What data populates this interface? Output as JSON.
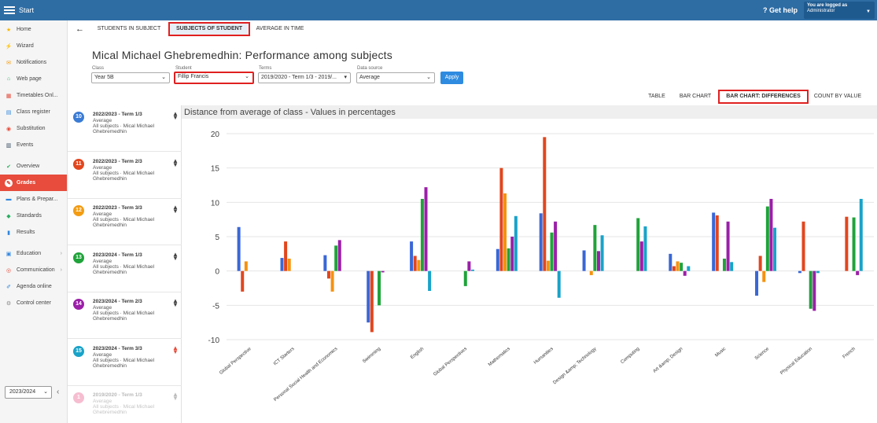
{
  "topbar": {
    "start": "Start",
    "help": "? Get help",
    "login_line1": "You are logged as",
    "login_line2": "Administrator"
  },
  "sidebar": {
    "items": [
      {
        "label": "Home",
        "icon": "star-icon",
        "color": "#f5b800"
      },
      {
        "label": "Wizard",
        "icon": "wand-icon",
        "color": "#e74c3c"
      },
      {
        "label": "Notifications",
        "icon": "envelope-icon",
        "color": "#f39c12"
      },
      {
        "label": "Web page",
        "icon": "house-icon",
        "color": "#27ae60"
      },
      {
        "label": "Timetables Onl...",
        "icon": "calendar-grid-icon",
        "color": "#e74c3c"
      },
      {
        "label": "Class register",
        "icon": "book-icon",
        "color": "#2e86de"
      },
      {
        "label": "Substitution",
        "icon": "user-swap-icon",
        "color": "#e74c3c"
      },
      {
        "label": "Events",
        "icon": "calendar-icon",
        "color": "#34495e"
      },
      {
        "label": "Overview",
        "icon": "check-circle-icon",
        "color": "#27ae60"
      },
      {
        "label": "Grades",
        "icon": "grades-icon",
        "color": "#ffffff"
      },
      {
        "label": "Plans & Prepar...",
        "icon": "plans-icon",
        "color": "#2e86de"
      },
      {
        "label": "Standards",
        "icon": "shield-icon",
        "color": "#27ae60"
      },
      {
        "label": "Results",
        "icon": "bar-chart-icon",
        "color": "#2e86de"
      },
      {
        "label": "Education",
        "icon": "education-icon",
        "color": "#2e86de"
      },
      {
        "label": "Communication",
        "icon": "chat-icon",
        "color": "#e74c3c"
      },
      {
        "label": "Agenda online",
        "icon": "pen-icon",
        "color": "#2e86de"
      },
      {
        "label": "Control center",
        "icon": "gear-icon",
        "color": "#888888"
      }
    ],
    "year": "2023/2024"
  },
  "tabs": {
    "students_in_subject": "STUDENTS IN SUBJECT",
    "subjects_of_student": "SUBJECTS OF STUDENT",
    "average_in_time": "AVERAGE IN TIME"
  },
  "page_title": "Mical Michael Ghebremedhin: Performance among subjects",
  "filters": {
    "class_label": "Class",
    "class_value": "Year 5B",
    "student_label": "Student",
    "student_value": "Fillip Francis",
    "terms_label": "Terms",
    "terms_value": "2019/2020 - Term 1/3 - 2019/...",
    "source_label": "Data source",
    "source_value": "Average",
    "apply": "Apply"
  },
  "view_tabs": {
    "table": "TABLE",
    "bar_chart": "BAR CHART",
    "bar_chart_diff": "BAR CHART: DIFFERENCES",
    "count_by_value": "COUNT BY VALUE"
  },
  "terms": [
    {
      "num": "10",
      "color": "#3a7bd5",
      "title": "2022/2023 - Term 1/3",
      "line1": "Average",
      "line2": "All subjects · Mical Michael Ghebremedhin"
    },
    {
      "num": "11",
      "color": "#e2461e",
      "title": "2022/2023 - Term 2/3",
      "line1": "Average",
      "line2": "All subjects · Mical Michael Ghebremedhin"
    },
    {
      "num": "12",
      "color": "#f39c12",
      "title": "2022/2023 - Term 3/3",
      "line1": "Average",
      "line2": "All subjects · Mical Michael Ghebremedhin"
    },
    {
      "num": "13",
      "color": "#1fa33a",
      "title": "2023/2024 - Term 1/3",
      "line1": "Average",
      "line2": "All subjects · Mical Michael Ghebremedhin"
    },
    {
      "num": "14",
      "color": "#9b1fa8",
      "title": "2023/2024 - Term 2/3",
      "line1": "Average",
      "line2": "All subjects · Mical Michael Ghebremedhin"
    },
    {
      "num": "15",
      "color": "#19a3c9",
      "title": "2023/2024 - Term 3/3",
      "line1": "Average",
      "line2": "All subjects · Mical Michael Ghebremedhin"
    },
    {
      "num": "1",
      "color": "#e8467a",
      "title": "2019/2020 - Term 1/3",
      "line1": "Average",
      "line2": "All subjects · Mical Michael Ghebremedhin"
    }
  ],
  "chart_data": {
    "type": "bar",
    "title": "Distance from average of class - Values in percentages",
    "ylim": [
      -10,
      20
    ],
    "yticks": [
      -10,
      -5,
      0,
      5,
      10,
      15,
      20
    ],
    "grid": true,
    "categories": [
      "Global Perspective",
      "ICT Starters",
      "Personal Social Health and Economics",
      "Swimming",
      "English",
      "Global Perspectives",
      "Mathematics",
      "Humanities",
      "Design &amp; Technology",
      "Computing",
      "Art &amp; Design",
      "Music",
      "Science",
      "Physical Education",
      "French"
    ],
    "series": [
      {
        "color": "#3a67d6",
        "values": [
          6.4,
          1.9,
          2.3,
          -7.5,
          4.3,
          0,
          3.2,
          8.4,
          3.0,
          0,
          2.5,
          8.5,
          -3.6,
          -0.3,
          0
        ]
      },
      {
        "color": "#e2461e",
        "values": [
          -3.0,
          4.3,
          -1.1,
          -8.9,
          2.2,
          0,
          15.0,
          19.5,
          0,
          0,
          0.7,
          8.1,
          2.2,
          7.2,
          7.9
        ]
      },
      {
        "color": "#f5920f",
        "values": [
          1.4,
          1.8,
          -3.0,
          0,
          1.6,
          0,
          11.3,
          1.5,
          -0.6,
          0,
          1.4,
          0,
          -1.6,
          0,
          0
        ]
      },
      {
        "color": "#1fa33a",
        "values": [
          0,
          0,
          3.7,
          -5.0,
          10.5,
          -2.2,
          3.3,
          5.6,
          6.7,
          7.7,
          1.2,
          1.8,
          9.4,
          -5.5,
          7.8
        ]
      },
      {
        "color": "#9b1fa8",
        "values": [
          0,
          0,
          4.5,
          -0.2,
          12.2,
          1.4,
          5.0,
          7.2,
          2.9,
          4.3,
          -0.7,
          7.2,
          10.5,
          -5.8,
          -0.6
        ]
      },
      {
        "color": "#19a3c9",
        "values": [
          0,
          0,
          0,
          0,
          -2.9,
          0.2,
          8.0,
          -3.9,
          5.2,
          6.5,
          0.7,
          1.3,
          6.3,
          -0.3,
          10.5
        ]
      }
    ]
  }
}
